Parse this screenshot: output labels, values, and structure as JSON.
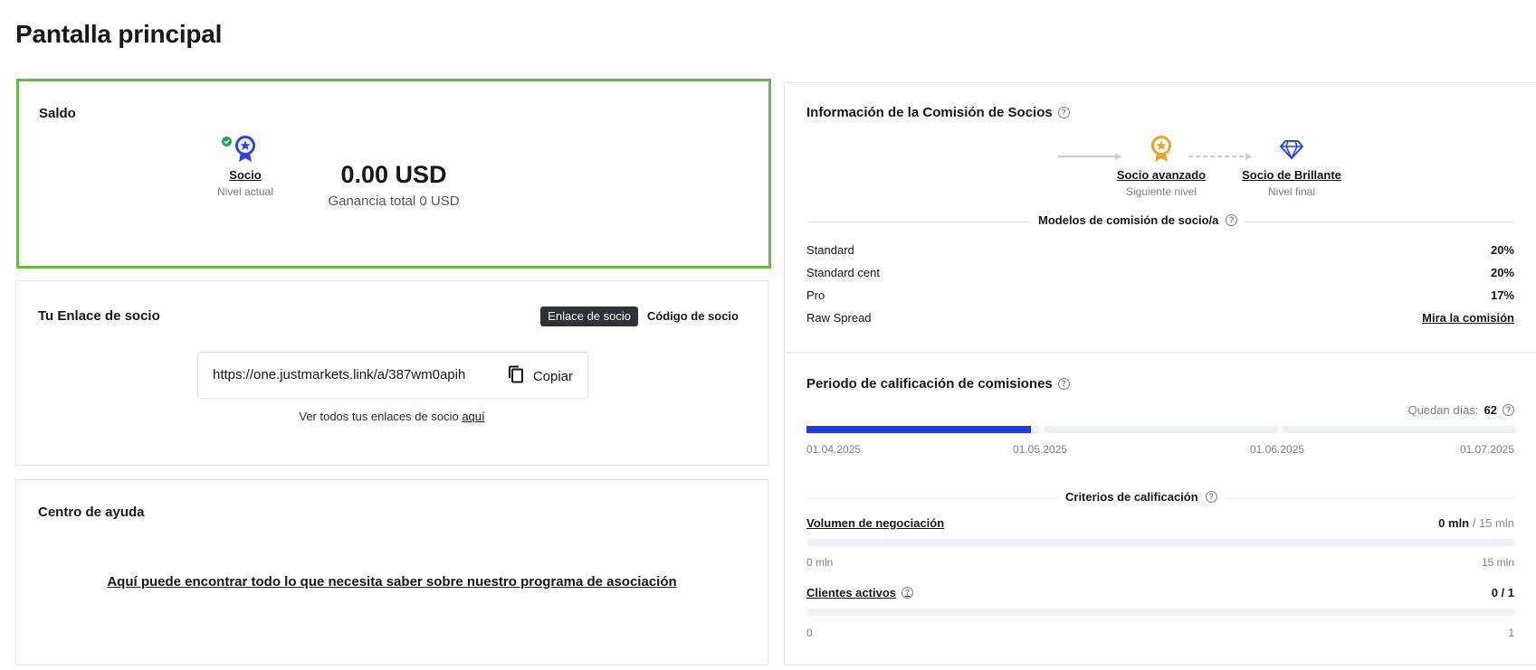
{
  "page": {
    "title": "Pantalla principal"
  },
  "balance": {
    "title": "Saldo",
    "amount": "0.00 USD",
    "total_earnings": "Ganancia total 0 USD"
  },
  "partner_link": {
    "title": "Tu Enlace de socio",
    "tab_link": "Enlace de socio",
    "tab_code": "Código de socio",
    "url": "https://one.justmarkets.link/a/387wm0apih",
    "copy_label": "Copiar",
    "hint_prefix": "Ver todos tus enlaces de socio ",
    "hint_link": "aquí"
  },
  "help_center": {
    "title": "Centro de ayuda",
    "link": "Aquí puede encontrar todo lo que necesita saber sobre nuestro programa de asociación"
  },
  "commission_info": {
    "title": "Información de la Comisión de Socios",
    "levels": [
      {
        "name": "Socio",
        "sub": "Nivel actual",
        "icon": "medal-star-icon",
        "color": "#2b45e6"
      },
      {
        "name": "Socio avanzado",
        "sub": "Siguiente nivel",
        "icon": "medal-star-icon",
        "color": "#e8a72a"
      },
      {
        "name": "Socio de Brillante",
        "sub": "Nivel final",
        "icon": "diamond-icon",
        "color": "#2b45e6"
      }
    ],
    "models_label": "Modelos de comisión de socio/a",
    "models": [
      {
        "name": "Standard",
        "value": "20%"
      },
      {
        "name": "Standard cent",
        "value": "20%"
      },
      {
        "name": "Pro",
        "value": "17%"
      },
      {
        "name": "Raw Spread",
        "value": "Mira la comisión"
      }
    ]
  },
  "qualification": {
    "title": "Periodo de calificación de comisiones",
    "days_left_label": "Quedan días:",
    "days_left_value": "62",
    "period_progress": 0.32,
    "dates": [
      "01.04.2025",
      "01.05.2025",
      "01.06.2025",
      "01.07.2025"
    ],
    "criteria_label": "Criterios de calificación",
    "volume": {
      "name": "Volumen de negociación",
      "current": "0 mln",
      "target": " / 15 mln",
      "min": "0 mln",
      "max": "15 mln"
    },
    "clients": {
      "name": "Clientes activos",
      "value": "0 / 1",
      "min": "0",
      "max": "1"
    }
  },
  "colors": {
    "accent": "#1f3bdc",
    "balance_border": "#6ab74a",
    "success": "#22a559",
    "gold": "#e8a72a"
  }
}
